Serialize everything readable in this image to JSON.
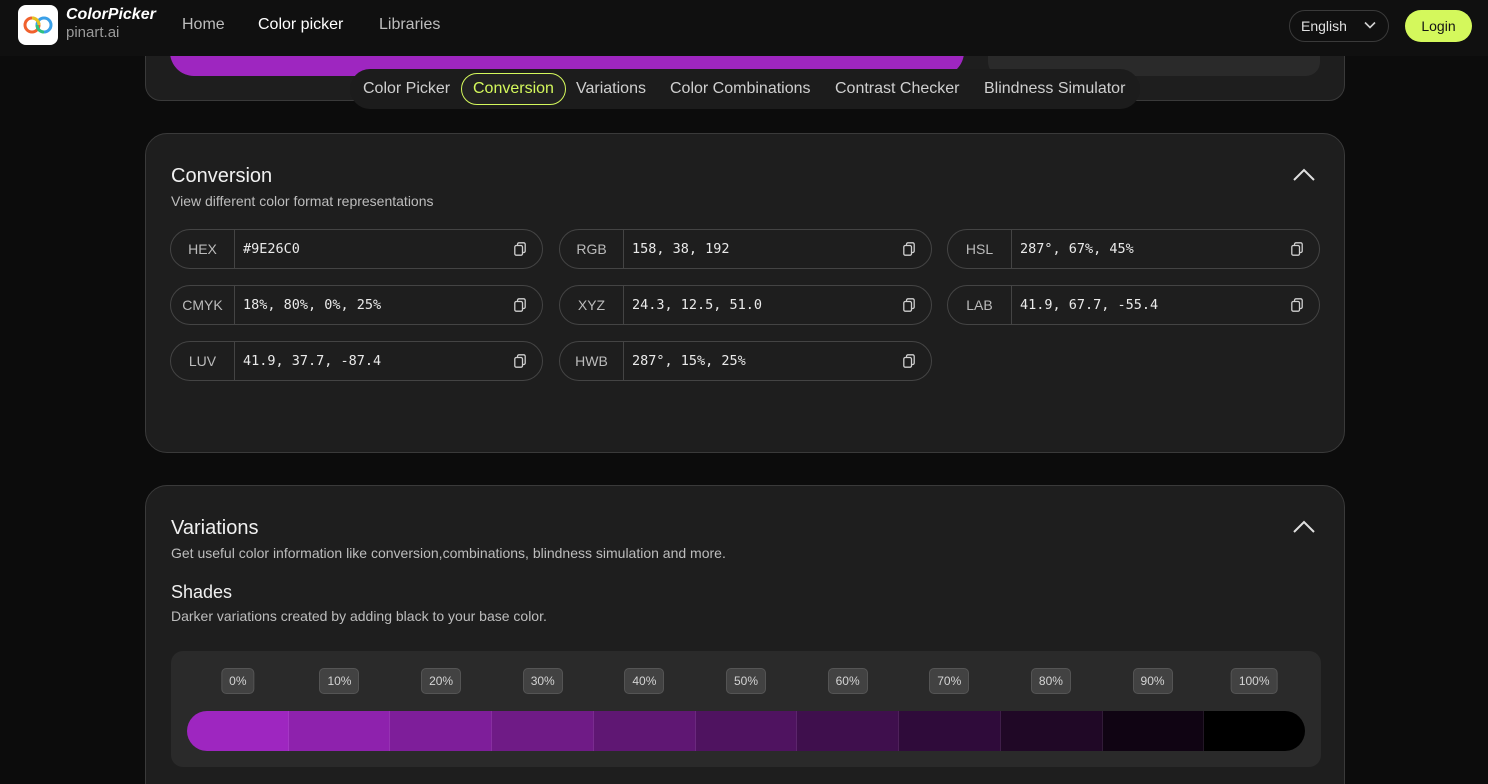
{
  "header": {
    "logo_title": "ColorPicker",
    "logo_sub": "pinart.ai",
    "nav": [
      "Home",
      "Color picker",
      "Libraries"
    ],
    "active_nav": "Color picker",
    "language": "English",
    "login_label": "Login",
    "accent_color": "#d4f85c"
  },
  "picker": {
    "color": "#9E26C0"
  },
  "tabs": [
    "Color Picker",
    "Conversion",
    "Variations",
    "Color Combinations",
    "Contrast Checker",
    "Blindness Simulator"
  ],
  "active_tab": "Conversion",
  "conversion": {
    "title": "Conversion",
    "subtitle": "View different color format representations",
    "fields": [
      {
        "label": "HEX",
        "value": "#9E26C0"
      },
      {
        "label": "RGB",
        "value": "158, 38, 192"
      },
      {
        "label": "HSL",
        "value": "287°, 67%, 45%"
      },
      {
        "label": "CMYK",
        "value": "18%, 80%, 0%, 25%"
      },
      {
        "label": "XYZ",
        "value": "24.3, 12.5, 51.0"
      },
      {
        "label": "LAB",
        "value": "41.9, 67.7, -55.4"
      },
      {
        "label": "LUV",
        "value": "41.9, 37.7, -87.4"
      },
      {
        "label": "HWB",
        "value": "287°, 15%, 25%"
      }
    ]
  },
  "variations": {
    "title": "Variations",
    "subtitle": "Get useful color information like conversion,combinations, blindness simulation and more.",
    "shades_title": "Shades",
    "shades_subtitle": "Darker variations created by adding black to your base color.",
    "shades": [
      {
        "label": "0%",
        "color": "#9e26c0"
      },
      {
        "label": "10%",
        "color": "#8e22ad"
      },
      {
        "label": "20%",
        "color": "#7e1e9a"
      },
      {
        "label": "30%",
        "color": "#6f1b86"
      },
      {
        "label": "40%",
        "color": "#5f1773"
      },
      {
        "label": "50%",
        "color": "#4f1360"
      },
      {
        "label": "60%",
        "color": "#3f0f4d"
      },
      {
        "label": "70%",
        "color": "#2f0b3a"
      },
      {
        "label": "80%",
        "color": "#200826"
      },
      {
        "label": "90%",
        "color": "#100413"
      },
      {
        "label": "100%",
        "color": "#000000"
      }
    ]
  }
}
